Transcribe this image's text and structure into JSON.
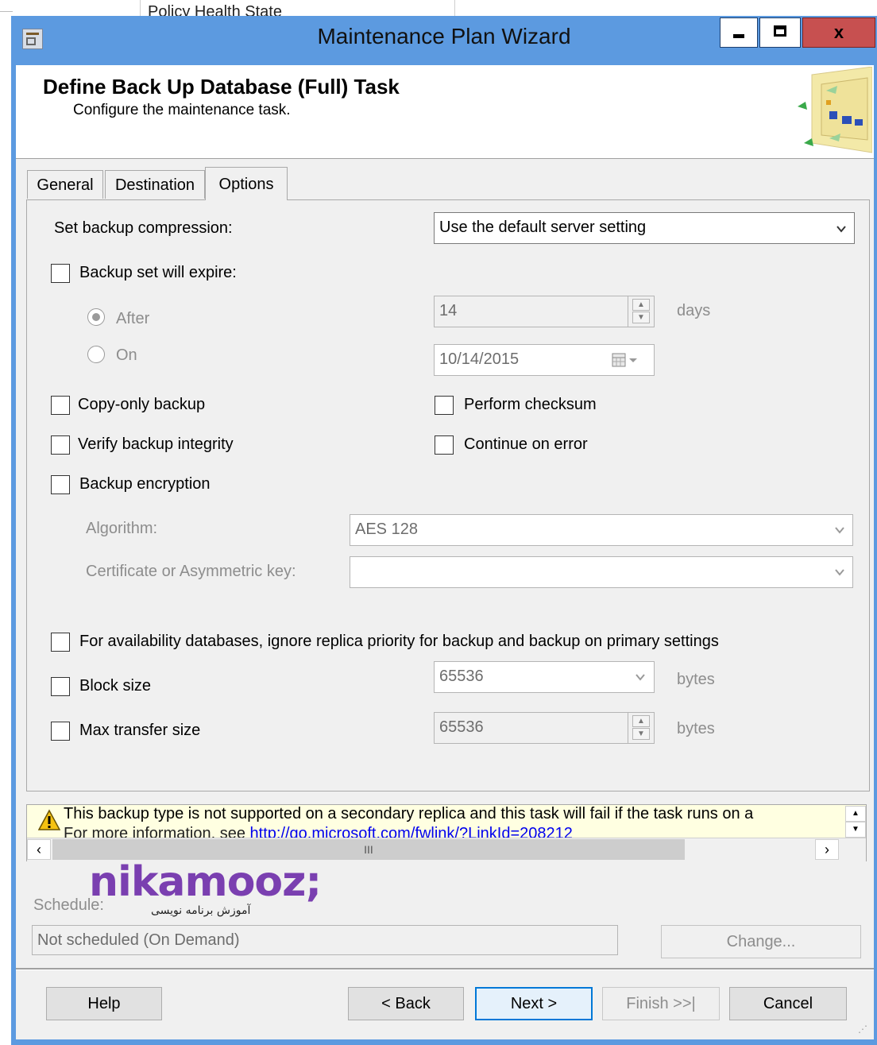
{
  "background_window": {
    "text": "Policy Health State"
  },
  "window": {
    "title": "Maintenance Plan Wizard",
    "close_label": "x"
  },
  "header": {
    "title": "Define Back Up Database (Full) Task",
    "subtitle": "Configure the maintenance task."
  },
  "tabs": [
    {
      "label": "General"
    },
    {
      "label": "Destination"
    },
    {
      "label": "Options",
      "selected": true
    }
  ],
  "options": {
    "compression_label": "Set backup compression:",
    "compression_value": "Use the default server setting",
    "expire_label": "Backup set will expire:",
    "after_label": "After",
    "after_value": "14",
    "after_unit": "days",
    "on_label": "On",
    "on_value": "10/14/2015",
    "copy_only_label": "Copy-only backup",
    "perform_checksum_label": "Perform checksum",
    "verify_label": "Verify backup integrity",
    "continue_on_error_label": "Continue on error",
    "encryption_label": "Backup encryption",
    "algorithm_label": "Algorithm:",
    "algorithm_value": "AES 128",
    "certificate_label": "Certificate or Asymmetric key:",
    "certificate_value": "",
    "availability_label": "For availability databases, ignore replica priority for backup and backup on primary settings",
    "block_size_label": "Block size",
    "block_size_value": "65536",
    "block_size_unit": "bytes",
    "max_transfer_label": "Max transfer size",
    "max_transfer_value": "65536",
    "max_transfer_unit": "bytes"
  },
  "warning": {
    "line1": "This backup type is not supported on a secondary replica and this task will fail if the task runs on a",
    "line2_prefix": "For more information, see ",
    "line2_link": "http://go.microsoft.com/fwlink/?LinkId=208212",
    "scroll_thumb_glyph": "III"
  },
  "watermark": {
    "logo": "nikamooz;",
    "tagline": "آموزش برنامه نویسی"
  },
  "schedule": {
    "label": "Schedule:",
    "value": "Not scheduled (On Demand)",
    "change_label": "Change..."
  },
  "buttons": {
    "help": "Help",
    "back": "< Back",
    "next": "Next >",
    "finish": "Finish >>|",
    "cancel": "Cancel"
  },
  "colors": {
    "titlebar": "#5c9ae0",
    "close_button": "#c75050",
    "warning_bg": "#ffffe1",
    "link": "#0000ee",
    "logo": "#7a3fb0"
  }
}
